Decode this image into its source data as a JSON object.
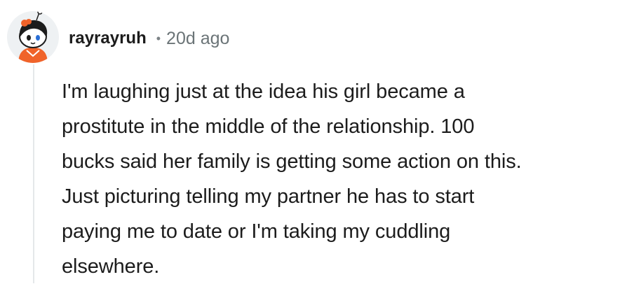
{
  "comment": {
    "author": "rayrayruh",
    "separator": "•",
    "age": "20d ago",
    "body": "I'm laughing just at the idea his girl became a\nprostitute in the middle of the relationship. 100\nbucks said her family is getting some action on this.\nJust picturing telling my partner he has to start\npaying me to date or I'm taking my cuddling\nelsewhere.",
    "avatar_icon": "snoo-avatar-icon",
    "colors": {
      "text": "#1c1c1c",
      "meta": "#6b7477",
      "thread_line": "#e5e8ea",
      "avatar_accent": "#f0632a"
    }
  }
}
